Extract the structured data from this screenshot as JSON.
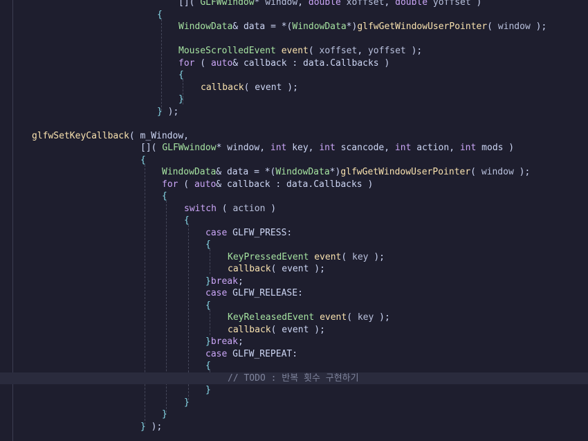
{
  "editor": {
    "language": "cpp",
    "current_line_index": 31,
    "colors": {
      "background": "#1e1e2e",
      "current_line": "#2a2b3d",
      "punctuation": "#cdd6f4",
      "keyword": "#cba6f7",
      "type": "#a6e3a1",
      "function": "#f9e2af",
      "parameter": "#bac2de",
      "variable": "#cdd6f4",
      "bracket": "#89dceb",
      "comment": "#7f849c"
    },
    "lines": [
      [
        [
          "p",
          "[]( "
        ],
        [
          "ty",
          "GLFWwindow"
        ],
        [
          "p",
          "* "
        ],
        [
          "pa",
          "window"
        ],
        [
          "p",
          ", "
        ],
        [
          "k",
          "double"
        ],
        [
          "p",
          " "
        ],
        [
          "pa",
          "xoffset"
        ],
        [
          "p",
          ", "
        ],
        [
          "k",
          "double"
        ],
        [
          "p",
          " "
        ],
        [
          "pa",
          "yoffset"
        ],
        [
          "p",
          " )"
        ]
      ],
      [
        [
          "br",
          "{"
        ]
      ],
      [
        [
          "ty",
          "WindowData"
        ],
        [
          "p",
          "& "
        ],
        [
          "v",
          "data"
        ],
        [
          "p",
          " = *("
        ],
        [
          "ty",
          "WindowData"
        ],
        [
          "p",
          "*)"
        ],
        [
          "f",
          "glfwGetWindowUserPointer"
        ],
        [
          "p",
          "( "
        ],
        [
          "pa",
          "window"
        ],
        [
          "p",
          " );"
        ]
      ],
      [],
      [
        [
          "ty",
          "MouseScrolledEvent"
        ],
        [
          "p",
          " "
        ],
        [
          "f",
          "event"
        ],
        [
          "p",
          "( "
        ],
        [
          "pa",
          "xoffset"
        ],
        [
          "p",
          ", "
        ],
        [
          "pa",
          "yoffset"
        ],
        [
          "p",
          " );"
        ]
      ],
      [
        [
          "k",
          "for"
        ],
        [
          "p",
          " ( "
        ],
        [
          "k",
          "auto"
        ],
        [
          "p",
          "& "
        ],
        [
          "v",
          "callback"
        ],
        [
          "p",
          " : "
        ],
        [
          "v",
          "data"
        ],
        [
          "p",
          "."
        ],
        [
          "v",
          "Callbacks"
        ],
        [
          "p",
          " )"
        ]
      ],
      [
        [
          "br",
          "{"
        ]
      ],
      [
        [
          "f",
          "callback"
        ],
        [
          "p",
          "( "
        ],
        [
          "v",
          "event"
        ],
        [
          "p",
          " );"
        ]
      ],
      [
        [
          "br",
          "}"
        ]
      ],
      [
        [
          "br",
          "}"
        ],
        [
          "p",
          " );"
        ]
      ],
      [],
      [
        [
          "f",
          "glfwSetKeyCallback"
        ],
        [
          "p",
          "( "
        ],
        [
          "v",
          "m_Window"
        ],
        [
          "p",
          ","
        ]
      ],
      [
        [
          "p",
          "[]( "
        ],
        [
          "ty",
          "GLFWwindow"
        ],
        [
          "p",
          "* "
        ],
        [
          "v",
          "window"
        ],
        [
          "p",
          ", "
        ],
        [
          "k",
          "int"
        ],
        [
          "p",
          " "
        ],
        [
          "v",
          "key"
        ],
        [
          "p",
          ", "
        ],
        [
          "k",
          "int"
        ],
        [
          "p",
          " "
        ],
        [
          "v",
          "scancode"
        ],
        [
          "p",
          ", "
        ],
        [
          "k",
          "int"
        ],
        [
          "p",
          " "
        ],
        [
          "v",
          "action"
        ],
        [
          "p",
          ", "
        ],
        [
          "k",
          "int"
        ],
        [
          "p",
          " "
        ],
        [
          "v",
          "mods"
        ],
        [
          "p",
          " )"
        ]
      ],
      [
        [
          "br",
          "{"
        ]
      ],
      [
        [
          "ty",
          "WindowData"
        ],
        [
          "p",
          "& "
        ],
        [
          "v",
          "data"
        ],
        [
          "p",
          " = *("
        ],
        [
          "ty",
          "WindowData"
        ],
        [
          "p",
          "*)"
        ],
        [
          "f",
          "glfwGetWindowUserPointer"
        ],
        [
          "p",
          "( "
        ],
        [
          "pa",
          "window"
        ],
        [
          "p",
          " );"
        ]
      ],
      [
        [
          "k",
          "for"
        ],
        [
          "p",
          " ( "
        ],
        [
          "k",
          "auto"
        ],
        [
          "p",
          "& "
        ],
        [
          "v",
          "callback"
        ],
        [
          "p",
          " : "
        ],
        [
          "v",
          "data"
        ],
        [
          "p",
          "."
        ],
        [
          "v",
          "Callbacks"
        ],
        [
          "p",
          " )"
        ]
      ],
      [
        [
          "br",
          "{"
        ]
      ],
      [
        [
          "k",
          "switch"
        ],
        [
          "p",
          " ( "
        ],
        [
          "pa",
          "action"
        ],
        [
          "p",
          " )"
        ]
      ],
      [
        [
          "br",
          "{"
        ]
      ],
      [
        [
          "k",
          "case"
        ],
        [
          "p",
          " "
        ],
        [
          "v",
          "GLFW_PRESS"
        ],
        [
          "p",
          ":"
        ]
      ],
      [
        [
          "br",
          "{"
        ]
      ],
      [
        [
          "ty",
          "KeyPressedEvent"
        ],
        [
          "p",
          " "
        ],
        [
          "f",
          "event"
        ],
        [
          "p",
          "( "
        ],
        [
          "pa",
          "key"
        ],
        [
          "p",
          " );"
        ]
      ],
      [
        [
          "f",
          "callback"
        ],
        [
          "p",
          "( "
        ],
        [
          "v",
          "event"
        ],
        [
          "p",
          " );"
        ]
      ],
      [
        [
          "br",
          "}"
        ],
        [
          "k",
          "break"
        ],
        [
          "p",
          ";"
        ]
      ],
      [
        [
          "k",
          "case"
        ],
        [
          "p",
          " "
        ],
        [
          "v",
          "GLFW_RELEASE"
        ],
        [
          "p",
          ":"
        ]
      ],
      [
        [
          "br",
          "{"
        ]
      ],
      [
        [
          "ty",
          "KeyReleasedEvent"
        ],
        [
          "p",
          " "
        ],
        [
          "f",
          "event"
        ],
        [
          "p",
          "( "
        ],
        [
          "pa",
          "key"
        ],
        [
          "p",
          " );"
        ]
      ],
      [
        [
          "f",
          "callback"
        ],
        [
          "p",
          "( "
        ],
        [
          "v",
          "event"
        ],
        [
          "p",
          " );"
        ]
      ],
      [
        [
          "br",
          "}"
        ],
        [
          "k",
          "break"
        ],
        [
          "p",
          ";"
        ]
      ],
      [
        [
          "k",
          "case"
        ],
        [
          "p",
          " "
        ],
        [
          "v",
          "GLFW_REPEAT"
        ],
        [
          "p",
          ":"
        ]
      ],
      [
        [
          "br",
          "{"
        ]
      ],
      [
        [
          "c",
          "// TODO : 반복 횟수 구현하기"
        ]
      ],
      [
        [
          "br",
          "}"
        ]
      ],
      [
        [
          "br",
          "}"
        ]
      ],
      [
        [
          "br",
          "}"
        ]
      ],
      [
        [
          "br",
          "}"
        ],
        [
          "p",
          " );"
        ]
      ]
    ]
  }
}
